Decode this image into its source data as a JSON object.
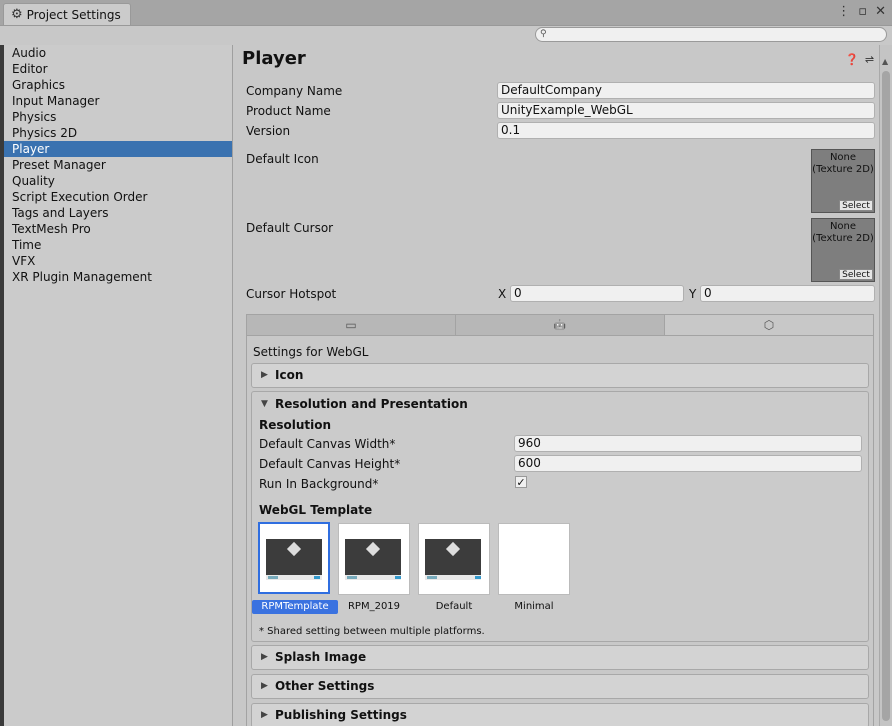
{
  "window": {
    "title": "Project Settings",
    "controls": [
      "⋮",
      "▫",
      "✕"
    ]
  },
  "search": {
    "placeholder": "",
    "value": ""
  },
  "sidebar": {
    "items": [
      {
        "label": "Audio"
      },
      {
        "label": "Editor"
      },
      {
        "label": "Graphics"
      },
      {
        "label": "Input Manager"
      },
      {
        "label": "Physics"
      },
      {
        "label": "Physics 2D"
      },
      {
        "label": "Player",
        "active": true
      },
      {
        "label": "Preset Manager"
      },
      {
        "label": "Quality"
      },
      {
        "label": "Script Execution Order"
      },
      {
        "label": "Tags and Layers"
      },
      {
        "label": "TextMesh Pro"
      },
      {
        "label": "Time"
      },
      {
        "label": "VFX"
      },
      {
        "label": "XR Plugin Management"
      }
    ]
  },
  "main": {
    "title": "Player",
    "header_icons": [
      "help-icon",
      "preset-icon",
      "gear-icon"
    ],
    "company_label": "Company Name",
    "company_value": "DefaultCompany",
    "product_label": "Product Name",
    "product_value": "UnityExample_WebGL",
    "version_label": "Version",
    "version_value": "0.1",
    "icon_label": "Default Icon",
    "icon_none": "None",
    "icon_type": "(Texture 2D)",
    "icon_select": "Select",
    "cursor_label": "Default Cursor",
    "cursor_none": "None",
    "cursor_type": "(Texture 2D)",
    "cursor_select": "Select",
    "hotspot_label": "Cursor Hotspot",
    "hotspot_x_label": "X",
    "hotspot_x": "0",
    "hotspot_y_label": "Y",
    "hotspot_y": "0"
  },
  "platform": {
    "tabs": [
      {
        "icon": "monitor-icon",
        "glyph": "▭"
      },
      {
        "icon": "android-icon",
        "glyph": "🤖"
      },
      {
        "icon": "html5-icon",
        "glyph": "⬡"
      }
    ],
    "selected_tab": 2,
    "settings_for": "Settings for WebGL",
    "icon_section": "Icon",
    "res_section": "Resolution and Presentation",
    "res_header": "Resolution",
    "canvas_width_label": "Default Canvas Width*",
    "canvas_width": "960",
    "canvas_height_label": "Default Canvas Height*",
    "canvas_height": "600",
    "run_bg_label": "Run In Background*",
    "run_bg_checked": "✓",
    "template_header": "WebGL Template",
    "templates": [
      {
        "name": "RPMTemplate",
        "selected": true,
        "preview": true
      },
      {
        "name": "RPM_2019",
        "selected": false,
        "preview": true
      },
      {
        "name": "Default",
        "selected": false,
        "preview": true
      },
      {
        "name": "Minimal",
        "selected": false,
        "preview": false
      }
    ],
    "shared_note": "* Shared setting between multiple platforms.",
    "splash_section": "Splash Image",
    "other_section": "Other Settings",
    "publishing_section": "Publishing Settings"
  }
}
